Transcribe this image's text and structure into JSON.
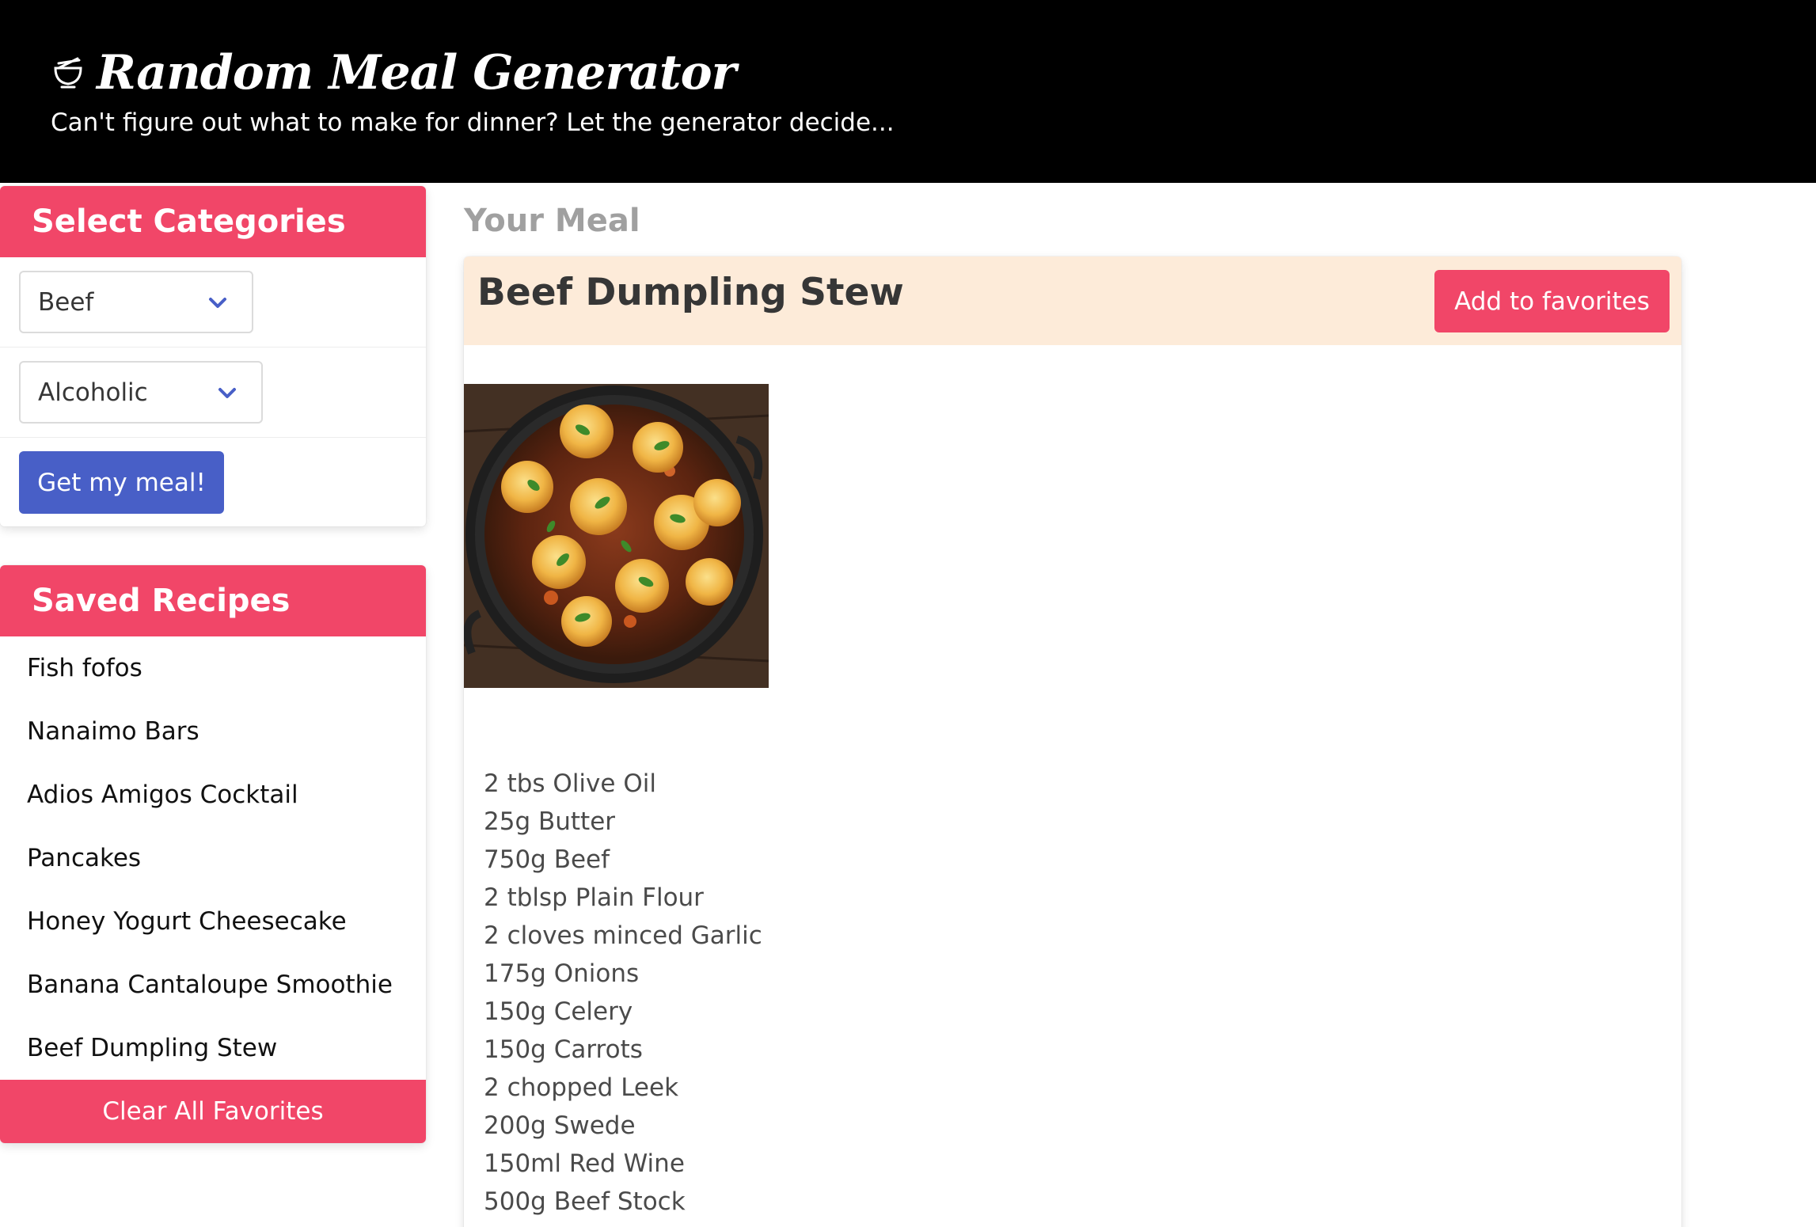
{
  "header": {
    "title": "Random Meal Generator",
    "subtitle": "Can't figure out what to make for dinner? Let the generator decide...",
    "icon": "bowl-icon"
  },
  "categories": {
    "heading": "Select Categories",
    "meal_select": {
      "value": "Beef"
    },
    "drink_select": {
      "value": "Alcoholic"
    },
    "submit_label": "Get my meal!"
  },
  "saved": {
    "heading": "Saved Recipes",
    "items": [
      "Fish fofos",
      "Nanaimo Bars",
      "Adios Amigos Cocktail",
      "Pancakes",
      "Honey Yogurt Cheesecake",
      "Banana Cantaloupe Smoothie",
      "Beef Dumpling Stew"
    ],
    "clear_label": "Clear All Favorites"
  },
  "meal": {
    "section_label": "Your Meal",
    "name": "Beef Dumpling Stew",
    "favorite_label": "Add to favorites",
    "ingredients": [
      "2 tbs Olive Oil",
      "25g Butter",
      "750g Beef",
      "2 tblsp Plain Flour",
      "2 cloves minced Garlic",
      "175g Onions",
      "150g Celery",
      "150g Carrots",
      "2 chopped Leek",
      "200g Swede",
      "150ml Red Wine",
      "500g Beef Stock"
    ]
  },
  "colors": {
    "accent": "#f14668",
    "primary": "#485fc7",
    "meal_header_bg": "#fdebd9",
    "header_bg": "#000000"
  }
}
